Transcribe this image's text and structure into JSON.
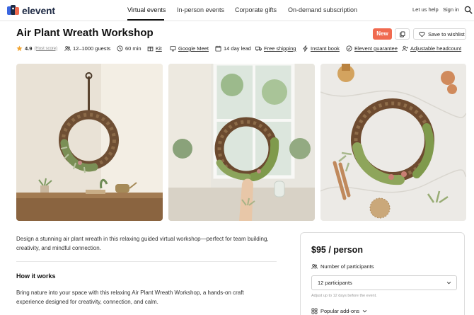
{
  "header": {
    "brand": "elevent",
    "nav": [
      "Virtual events",
      "In-person events",
      "Corporate gifts",
      "On-demand subscription"
    ],
    "help": "Let us help",
    "signin": "Sign in"
  },
  "event": {
    "title": "Air Plant Wreath Workshop",
    "badge": "New",
    "wishlist": "Save to wishlist",
    "rating": "4.9",
    "host_score": "(Host score)",
    "guests": "12–1000 guests",
    "duration": "60 min",
    "kit": "Kit",
    "platform": "Google Meet",
    "lead": "14 day lead",
    "shipping": "Free shipping",
    "instant": "Instant book",
    "guarantee": "Elevent guarantee",
    "headcount": "Adjustable headcount"
  },
  "description": "Design a stunning air plant wreath in this relaxing guided virtual workshop—perfect for team building, creativity, and mindful connection.",
  "how": {
    "title": "How it works",
    "body": "Bring nature into your space with this relaxing Air Plant Wreath Workshop, a hands-on craft experience designed for creativity, connection, and calm."
  },
  "booking": {
    "price": "$95 / person",
    "participants_label": "Number of participants",
    "participants_value": "12 participants",
    "hint": "Adjust up to 12 days before the event.",
    "addons": "Popular add-ons"
  },
  "colors": {
    "accent": "#f06a4f",
    "brand": "#1e2a44",
    "star": "#f2a531"
  }
}
